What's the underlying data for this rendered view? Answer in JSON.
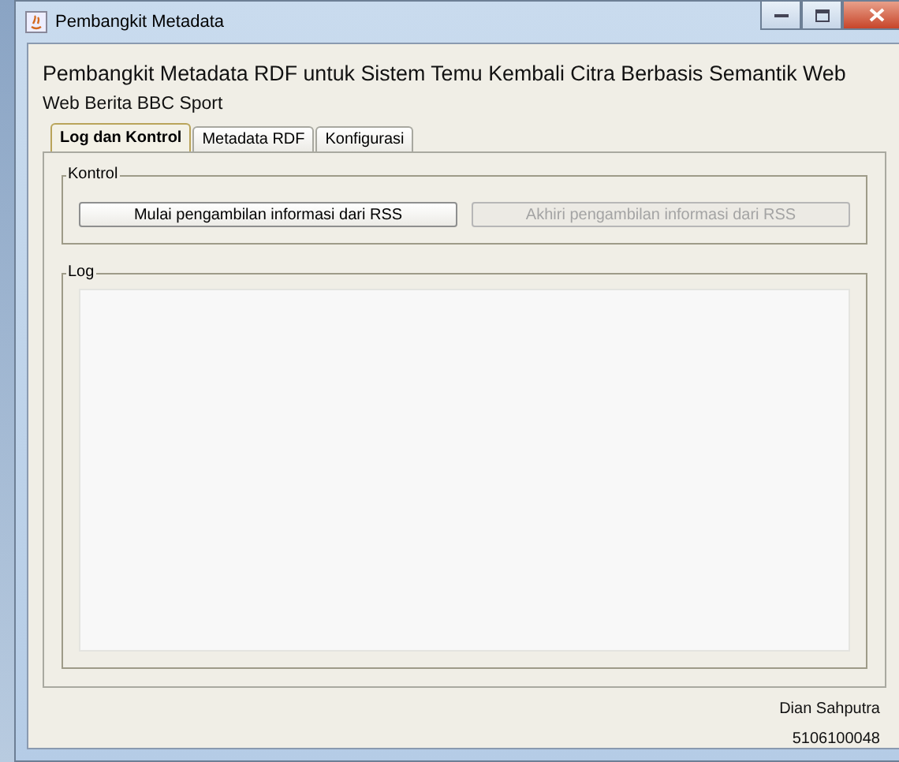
{
  "window": {
    "title": "Pembangkit Metadata"
  },
  "heading": "Pembangkit Metadata RDF untuk Sistem Temu Kembali Citra Berbasis Semantik Web",
  "subheading": "Web Berita BBC Sport",
  "tabs": [
    {
      "label": "Log dan Kontrol",
      "selected": true
    },
    {
      "label": "Metadata RDF",
      "selected": false
    },
    {
      "label": "Konfigurasi",
      "selected": false
    }
  ],
  "kontrol": {
    "title": "Kontrol",
    "buttons": [
      {
        "label": "Mulai pengambilan informasi dari RSS",
        "disabled": false
      },
      {
        "label": "Akhiri pengambilan informasi dari RSS",
        "disabled": true
      }
    ]
  },
  "log": {
    "title": "Log"
  },
  "footer": {
    "name": "Dian Sahputra",
    "id": "5106100048"
  }
}
